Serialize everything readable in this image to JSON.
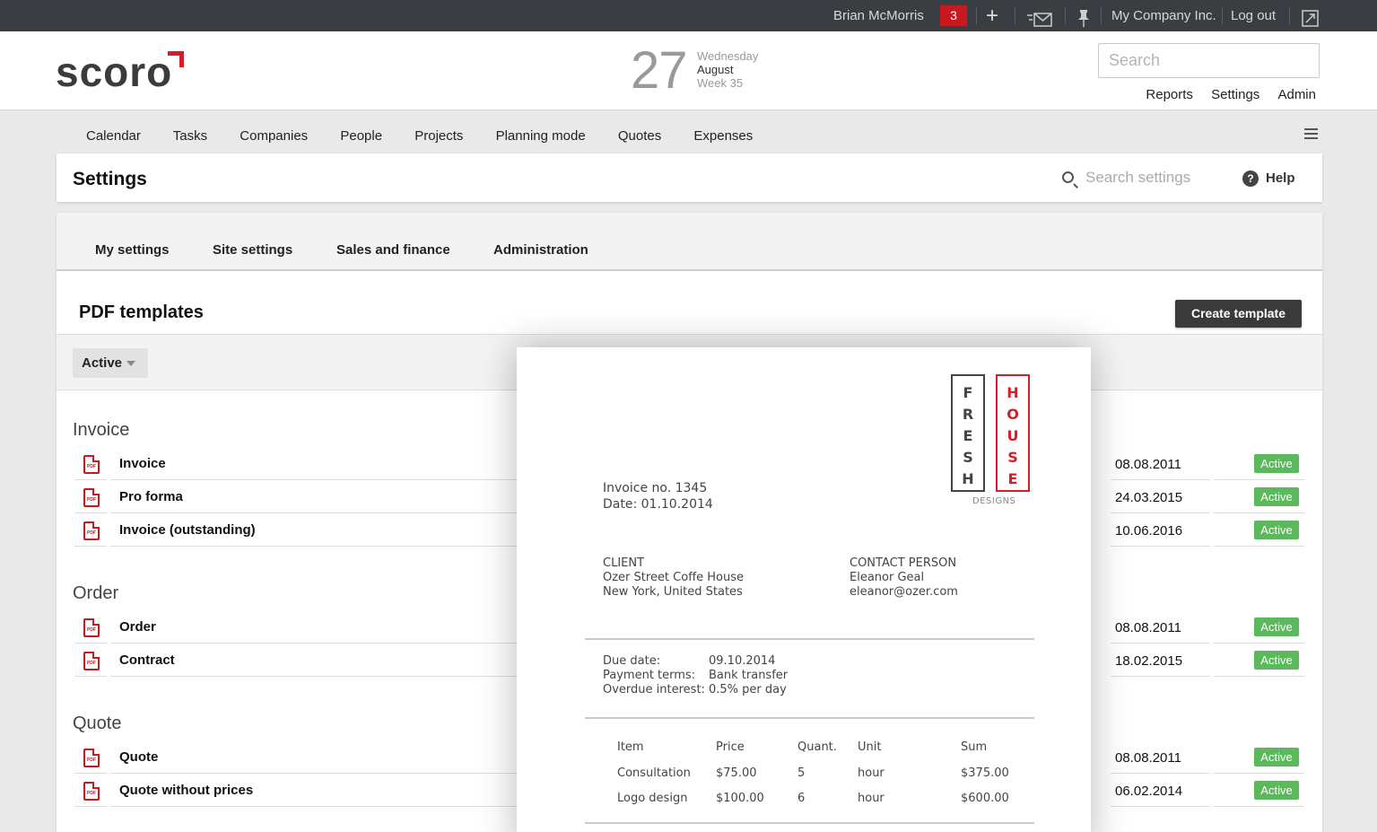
{
  "topbar": {
    "user": "Brian McMorris",
    "notifications": "3",
    "company": "My Company Inc.",
    "logout": "Log out"
  },
  "header": {
    "logo": "scoro",
    "date": {
      "day": "27",
      "weekday": "Wednesday",
      "month": "August",
      "week": "Week 35"
    },
    "search_placeholder": "Search",
    "links": [
      "Reports",
      "Settings",
      "Admin"
    ]
  },
  "nav": [
    "Calendar",
    "Tasks",
    "Companies",
    "People",
    "Projects",
    "Planning mode",
    "Quotes",
    "Expenses"
  ],
  "settings": {
    "title": "Settings",
    "search_placeholder": "Search settings",
    "help": "Help"
  },
  "tabs": [
    "My settings",
    "Site settings",
    "Sales and finance",
    "Administration"
  ],
  "section": {
    "title": "PDF templates",
    "create_button": "Create template",
    "filter": "Active"
  },
  "groups": [
    {
      "title": "Invoice",
      "rows": [
        {
          "name": "Invoice",
          "date": "08.08.2011",
          "status": "Active"
        },
        {
          "name": "Pro forma",
          "date": "24.03.2015",
          "status": "Active"
        },
        {
          "name": "Invoice (outstanding)",
          "date": "10.06.2016",
          "status": "Active"
        }
      ]
    },
    {
      "title": "Order",
      "rows": [
        {
          "name": "Order",
          "date": "08.08.2011",
          "status": "Active"
        },
        {
          "name": "Contract",
          "date": "18.02.2015",
          "status": "Active"
        }
      ]
    },
    {
      "title": "Quote",
      "rows": [
        {
          "name": "Quote",
          "date": "08.08.2011",
          "status": "Active"
        },
        {
          "name": "Quote without prices",
          "date": "06.02.2014",
          "status": "Active"
        }
      ]
    }
  ],
  "preview": {
    "invoice_no": "Invoice no. 1345",
    "date": "Date:  01.10.2014",
    "logo_left": [
      "F",
      "R",
      "E",
      "S",
      "H"
    ],
    "logo_right": [
      "H",
      "O",
      "U",
      "S",
      "E"
    ],
    "logo_sub": "DESIGNS",
    "client": {
      "label": "CLIENT",
      "name": "Ozer Street Coffe House",
      "location": "New York, United States"
    },
    "contact": {
      "label": "CONTACT PERSON",
      "name": "Eleanor Geal",
      "email": "eleanor@ozer.com"
    },
    "terms": [
      {
        "label": "Due date:",
        "value": "09.10.2014"
      },
      {
        "label": "Payment terms:",
        "value": "Bank transfer"
      },
      {
        "label": "Overdue interest:",
        "value": "0.5% per day"
      }
    ],
    "table": {
      "headers": [
        "Item",
        "Price",
        "Quant.",
        "Unit",
        "Sum"
      ],
      "rows": [
        [
          "Consultation",
          "$75.00",
          "5",
          "hour",
          "$375.00"
        ],
        [
          "Logo design",
          "$100.00",
          "6",
          "hour",
          "$600.00"
        ]
      ]
    }
  }
}
